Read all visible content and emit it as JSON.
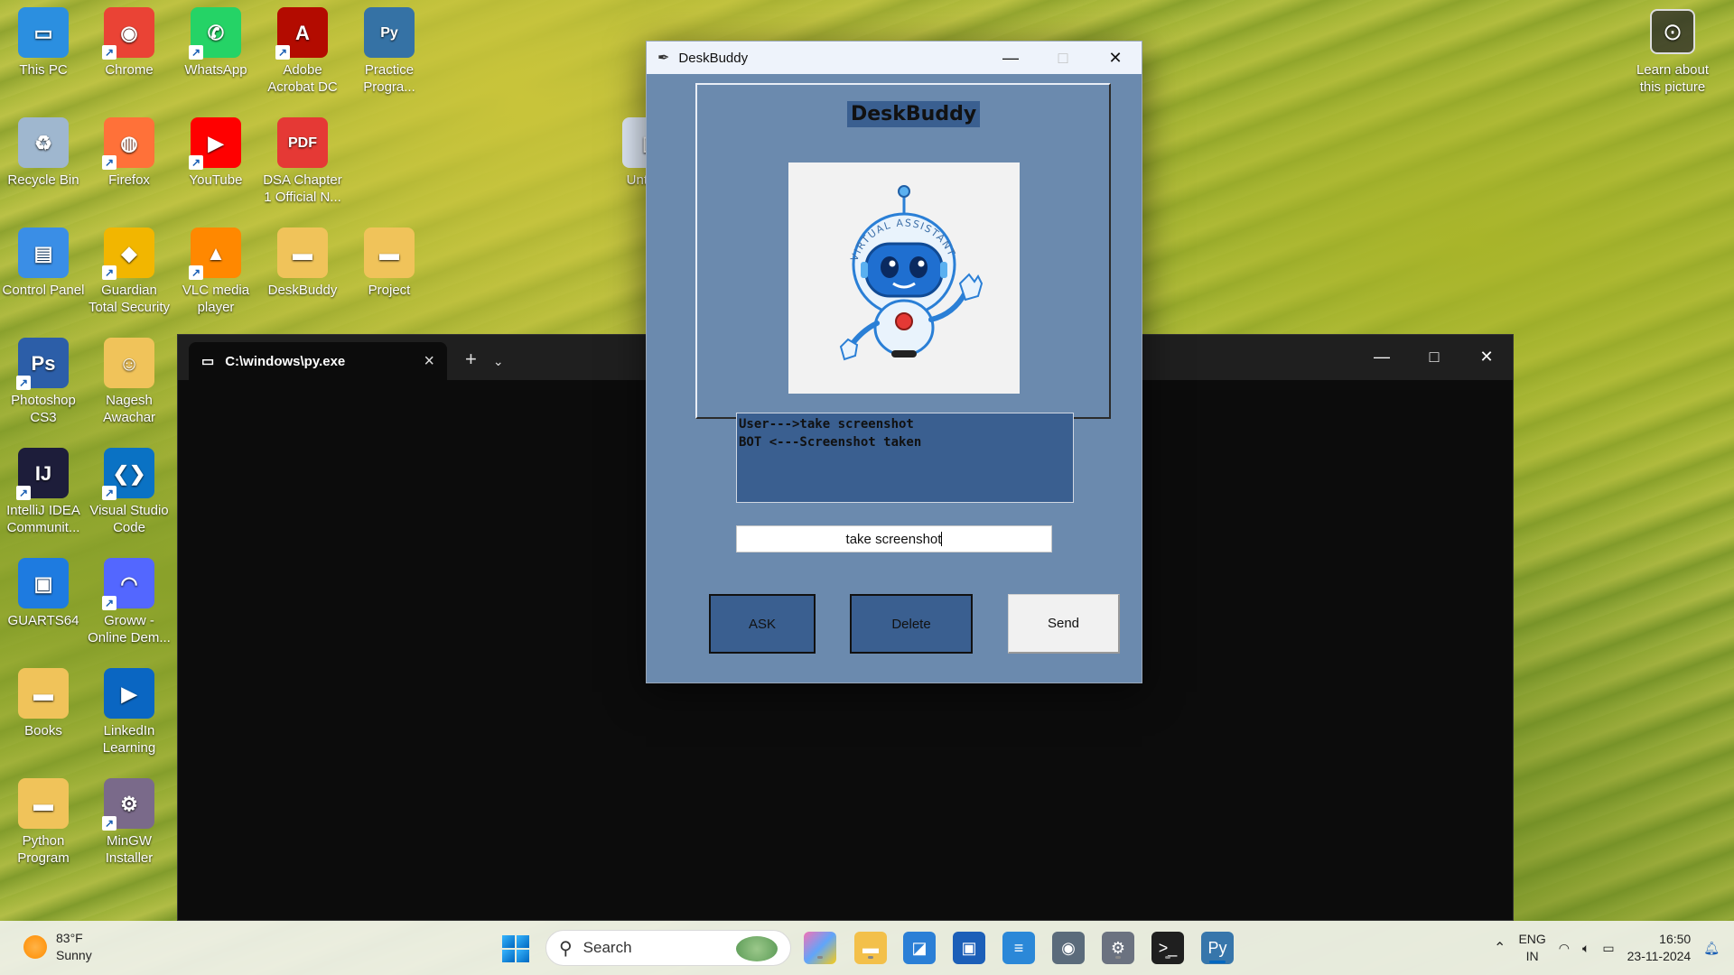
{
  "desktop": {
    "icons": [
      {
        "label": "This PC",
        "icon": "monitor-icon",
        "color": "#2b8fe0"
      },
      {
        "label": "Chrome",
        "icon": "chrome-icon",
        "color": "#ea4335"
      },
      {
        "label": "WhatsApp",
        "icon": "whatsapp-icon",
        "color": "#25d366"
      },
      {
        "label": "Adobe Acrobat DC",
        "icon": "acrobat-icon",
        "color": "#b30b00"
      },
      {
        "label": "Practice Progra...",
        "icon": "python-file-icon",
        "color": "#3572a5"
      },
      {
        "label": "Recycle Bin",
        "icon": "recycle-bin-icon",
        "color": "#9fb7cf"
      },
      {
        "label": "Firefox",
        "icon": "firefox-icon",
        "color": "#ff7139"
      },
      {
        "label": "YouTube",
        "icon": "youtube-icon",
        "color": "#ff0000"
      },
      {
        "label": "DSA Chapter 1 Official N...",
        "icon": "pdf-icon",
        "color": "#e53935"
      },
      {
        "label": "Control Panel",
        "icon": "control-panel-icon",
        "color": "#3a8ee6"
      },
      {
        "label": "Guardian Total Security",
        "icon": "guardian-icon",
        "color": "#f2b600"
      },
      {
        "label": "VLC media player",
        "icon": "vlc-icon",
        "color": "#ff8800"
      },
      {
        "label": "DeskBuddy",
        "icon": "folder-icon",
        "color": "#f0c35a"
      },
      {
        "label": "Project",
        "icon": "folder-icon",
        "color": "#f0c35a"
      },
      {
        "label": "Photoshop CS3",
        "icon": "photoshop-icon",
        "color": "#2c5ea8"
      },
      {
        "label": "Nagesh Awachar",
        "icon": "user-folder-icon",
        "color": "#f0c35a"
      },
      {
        "label": "IntelliJ IDEA Communit...",
        "icon": "intellij-icon",
        "color": "#1d1d3a"
      },
      {
        "label": "Visual Studio Code",
        "icon": "vscode-icon",
        "color": "#0a72c4"
      },
      {
        "label": "GUARTS64",
        "icon": "app-window-icon",
        "color": "#1e7be0"
      },
      {
        "label": "Groww - Online Dem...",
        "icon": "groww-icon",
        "color": "#5367ff"
      },
      {
        "label": "Books",
        "icon": "folder-icon",
        "color": "#f0c35a"
      },
      {
        "label": "LinkedIn Learning",
        "icon": "linkedin-learning-icon",
        "color": "#0a66c2"
      },
      {
        "label": "Python Program",
        "icon": "folder-icon",
        "color": "#f0c35a"
      },
      {
        "label": "MinGW Installer",
        "icon": "installer-icon",
        "color": "#7a6a8a"
      },
      {
        "label": "Untitl...",
        "icon": "file-icon",
        "color": "#dfe8f5"
      }
    ],
    "learn_about": "Learn about this picture"
  },
  "terminal": {
    "tab_title": "C:\\windows\\py.exe",
    "new_tab": "+",
    "dropdown": "⌄"
  },
  "deskbuddy": {
    "window_title": "DeskBuddy",
    "heading": "DeskBuddy",
    "robot_badge": "VIRTUAL ASSISTANT",
    "chat_lines": "User--->take screenshot\nBOT <---Screenshot taken",
    "input_value": "take screenshot",
    "buttons": {
      "ask": "ASK",
      "delete": "Delete",
      "send": "Send"
    }
  },
  "taskbar": {
    "weather_temp": "83°F",
    "weather_desc": "Sunny",
    "search_placeholder": "Search",
    "lang_top": "ENG",
    "lang_bottom": "IN",
    "time": "16:50",
    "date": "23-11-2024"
  }
}
